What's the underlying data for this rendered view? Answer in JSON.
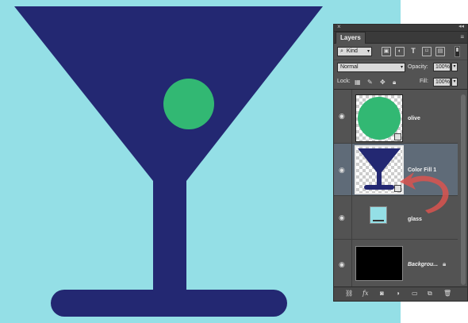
{
  "canvas": {
    "background": "#94dfe6",
    "glass_color": "#232872",
    "olive_color": "#32b873"
  },
  "panel": {
    "close_glyph": "×",
    "collapse_glyph": "◂◂",
    "tab_label": "Layers",
    "menu_glyph": "≡",
    "filter": {
      "kind_label": "Kind",
      "search_icon": "⌕",
      "icons": [
        "image-filter-icon",
        "adjustment-filter-icon",
        "type-filter-icon",
        "shape-filter-icon",
        "smart-object-filter-icon"
      ]
    },
    "blend_mode": "Normal",
    "opacity_label": "Opacity:",
    "opacity_value": "100%",
    "lock_label": "Lock:",
    "fill_label": "Fill:",
    "fill_value": "100%",
    "layers": [
      {
        "name": "olive",
        "visible": true,
        "selected": false
      },
      {
        "name": "Color Fill 1",
        "visible": true,
        "selected": true
      },
      {
        "name": "glass",
        "visible": true,
        "selected": false
      },
      {
        "name": "Backgrou...",
        "visible": true,
        "selected": false,
        "locked": true
      }
    ],
    "bottom_icons": [
      "link-layers-icon",
      "fx-icon",
      "add-mask-icon",
      "adjustment-layer-icon",
      "new-group-icon",
      "new-layer-icon",
      "delete-layer-icon"
    ]
  },
  "annotation": {
    "arrow_color": "#d9534f"
  }
}
